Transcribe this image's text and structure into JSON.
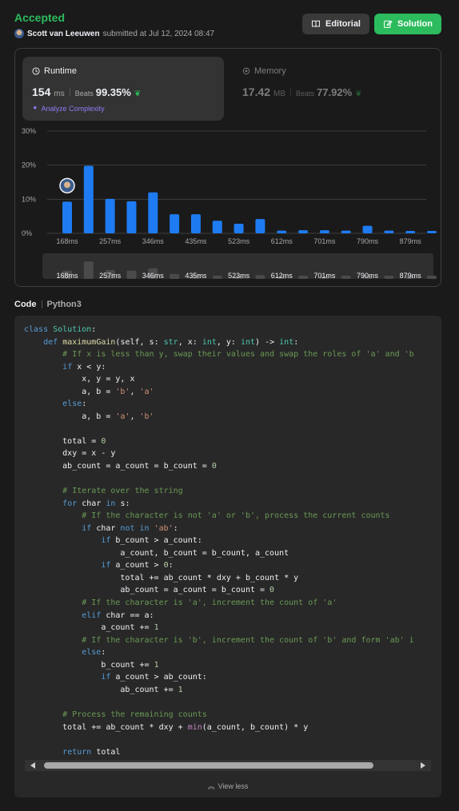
{
  "header": {
    "status": "Accepted",
    "submitter": "Scott van Leeuwen",
    "submitted_text": "submitted at Jul 12, 2024 08:47",
    "editorial_label": "Editorial",
    "solution_label": "Solution"
  },
  "runtime": {
    "title": "Runtime",
    "value": "154",
    "unit": "ms",
    "beats_label": "Beats",
    "beats_value": "99.35%",
    "analyze_label": "Analyze Complexity"
  },
  "memory": {
    "title": "Memory",
    "value": "17.42",
    "unit": "MB",
    "beats_label": "Beats",
    "beats_value": "77.92%"
  },
  "colors": {
    "accent": "#2cbb5d",
    "bar": "#1e7bf2",
    "mini_bar": "#4a4a4a",
    "purple": "#8f7cf5"
  },
  "chart_data": {
    "type": "bar",
    "ylim": [
      0,
      30
    ],
    "yticks": [
      "30%",
      "20%",
      "10%",
      "0%"
    ],
    "ytick_values": [
      30,
      20,
      10,
      0
    ],
    "xtick_labels": [
      "168ms",
      "257ms",
      "346ms",
      "435ms",
      "523ms",
      "612ms",
      "701ms",
      "790ms",
      "879ms"
    ],
    "values": [
      9.3,
      19.8,
      10.1,
      9.4,
      12.0,
      5.6,
      5.6,
      3.7,
      2.8,
      4.2,
      0.8,
      0.9,
      0.9,
      0.8,
      2.2,
      0.8,
      0.7,
      0.7
    ],
    "user_bar_index": 0,
    "grid": true
  },
  "code": {
    "label": "Code",
    "language": "Python3",
    "view_less": "View less",
    "lines": [
      [
        [
          "kw",
          "class "
        ],
        [
          "cls",
          "Solution"
        ],
        [
          "",
          ""
        ],
        [
          "",
          ":"
        ]
      ],
      [
        [
          "",
          "    "
        ],
        [
          "kw",
          "def "
        ],
        [
          "fn",
          "maximumGain"
        ],
        [
          "",
          "(self, s: "
        ],
        [
          "cls",
          "str"
        ],
        [
          "",
          ", x: "
        ],
        [
          "cls",
          "int"
        ],
        [
          "",
          ", y: "
        ],
        [
          "cls",
          "int"
        ],
        [
          "",
          ") -> "
        ],
        [
          "cls",
          "int"
        ],
        [
          "",
          ":"
        ]
      ],
      [
        [
          "",
          "        "
        ],
        [
          "cm",
          "# If x is less than y, swap their values and swap the roles of 'a' and 'b"
        ]
      ],
      [
        [
          "",
          "        "
        ],
        [
          "kw",
          "if "
        ],
        [
          "",
          "x < y:"
        ]
      ],
      [
        [
          "",
          "            x, y = y, x"
        ]
      ],
      [
        [
          "",
          "            a, b = "
        ],
        [
          "st",
          "'b'"
        ],
        [
          "",
          ", "
        ],
        [
          "st",
          "'a'"
        ]
      ],
      [
        [
          "",
          "        "
        ],
        [
          "kw",
          "else"
        ],
        [
          "",
          ":"
        ]
      ],
      [
        [
          "",
          "            a, b = "
        ],
        [
          "st",
          "'a'"
        ],
        [
          "",
          ", "
        ],
        [
          "st",
          "'b'"
        ]
      ],
      [
        [
          "",
          ""
        ]
      ],
      [
        [
          "",
          "        total = "
        ],
        [
          "nu",
          "0"
        ]
      ],
      [
        [
          "",
          "        dxy = x - y"
        ]
      ],
      [
        [
          "",
          "        ab_count = a_count = b_count = "
        ],
        [
          "nu",
          "0"
        ]
      ],
      [
        [
          "",
          ""
        ]
      ],
      [
        [
          "",
          "        "
        ],
        [
          "cm",
          "# Iterate over the string"
        ]
      ],
      [
        [
          "",
          "        "
        ],
        [
          "kw",
          "for "
        ],
        [
          "",
          "char "
        ],
        [
          "kw",
          "in "
        ],
        [
          "",
          "s:"
        ]
      ],
      [
        [
          "",
          "            "
        ],
        [
          "cm",
          "# If the character is not 'a' or 'b', process the current counts"
        ]
      ],
      [
        [
          "",
          "            "
        ],
        [
          "kw",
          "if "
        ],
        [
          "",
          "char "
        ],
        [
          "kw",
          "not in "
        ],
        [
          "st",
          "'ab'"
        ],
        [
          "",
          ":"
        ]
      ],
      [
        [
          "",
          "                "
        ],
        [
          "kw",
          "if "
        ],
        [
          "",
          "b_count > a_count:"
        ]
      ],
      [
        [
          "",
          "                    a_count, b_count = b_count, a_count"
        ]
      ],
      [
        [
          "",
          "                "
        ],
        [
          "kw",
          "if "
        ],
        [
          "",
          "a_count > "
        ],
        [
          "nu",
          "0"
        ],
        [
          "",
          ":"
        ]
      ],
      [
        [
          "",
          "                    total += ab_count * dxy + b_count * y"
        ]
      ],
      [
        [
          "",
          "                    ab_count = a_count = b_count = "
        ],
        [
          "nu",
          "0"
        ]
      ],
      [
        [
          "",
          "            "
        ],
        [
          "cm",
          "# If the character is 'a', increment the count of 'a'"
        ]
      ],
      [
        [
          "",
          "            "
        ],
        [
          "kw",
          "elif "
        ],
        [
          "",
          "char == a:"
        ]
      ],
      [
        [
          "",
          "                a_count += "
        ],
        [
          "nu",
          "1"
        ]
      ],
      [
        [
          "",
          "            "
        ],
        [
          "cm",
          "# If the character is 'b', increment the count of 'b' and form 'ab' i"
        ]
      ],
      [
        [
          "",
          "            "
        ],
        [
          "kw",
          "else"
        ],
        [
          "",
          ":"
        ]
      ],
      [
        [
          "",
          "                b_count += "
        ],
        [
          "nu",
          "1"
        ]
      ],
      [
        [
          "",
          "                "
        ],
        [
          "kw",
          "if "
        ],
        [
          "",
          "a_count > ab_count:"
        ]
      ],
      [
        [
          "",
          "                    ab_count += "
        ],
        [
          "nu",
          "1"
        ]
      ],
      [
        [
          "",
          ""
        ]
      ],
      [
        [
          "",
          "        "
        ],
        [
          "cm",
          "# Process the remaining counts"
        ]
      ],
      [
        [
          "",
          "        total += ab_count * dxy + "
        ],
        [
          "bi",
          "min"
        ],
        [
          "",
          "(a_count, b_count) * y"
        ]
      ],
      [
        [
          "",
          ""
        ]
      ],
      [
        [
          "",
          "        "
        ],
        [
          "kw",
          "return "
        ],
        [
          "",
          "total"
        ]
      ]
    ]
  }
}
